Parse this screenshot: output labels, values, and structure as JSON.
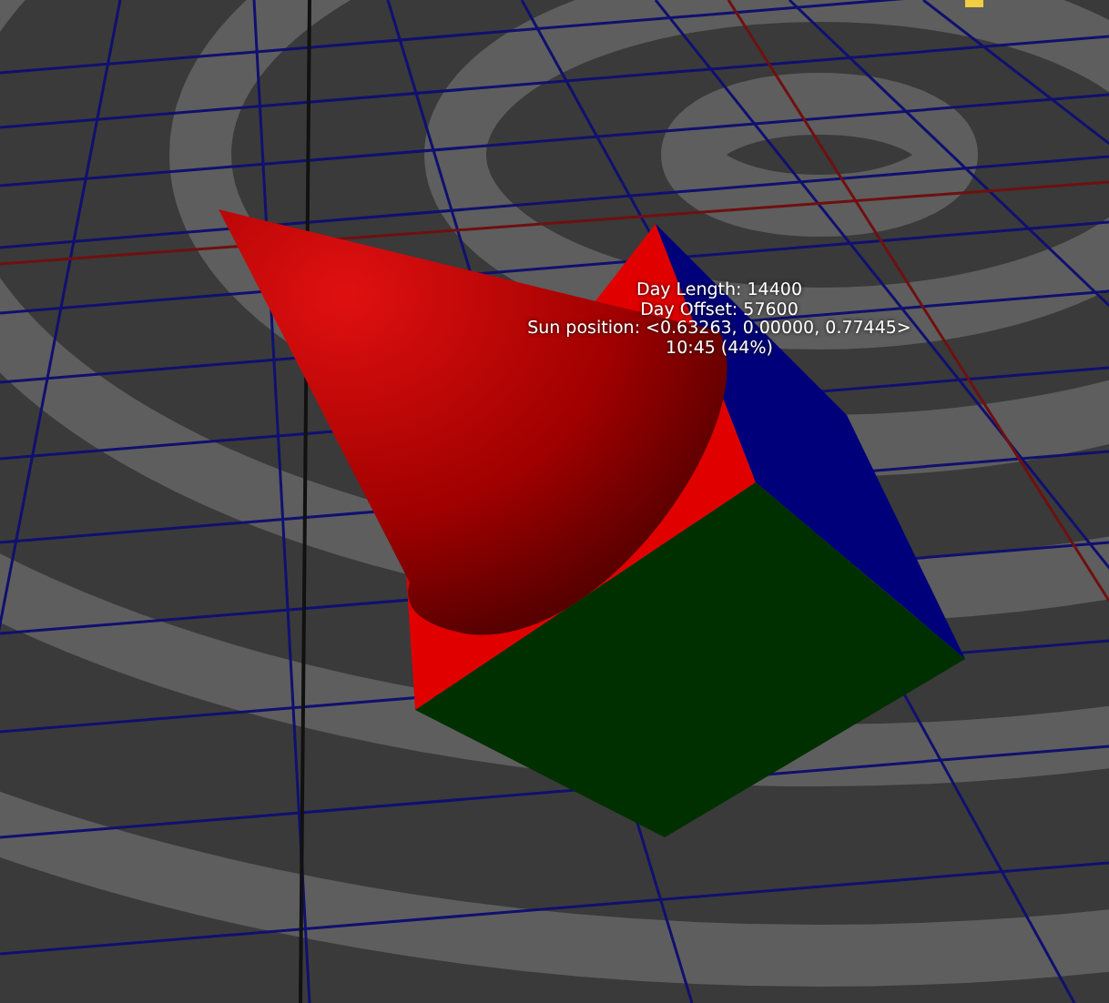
{
  "viewport": {
    "overlay_lines": [
      "Day Length: 14400",
      "Day Offset: 57600",
      "Sun position: <0.63263, 0.00000, 0.77445>",
      "10:45 (44%)"
    ]
  }
}
